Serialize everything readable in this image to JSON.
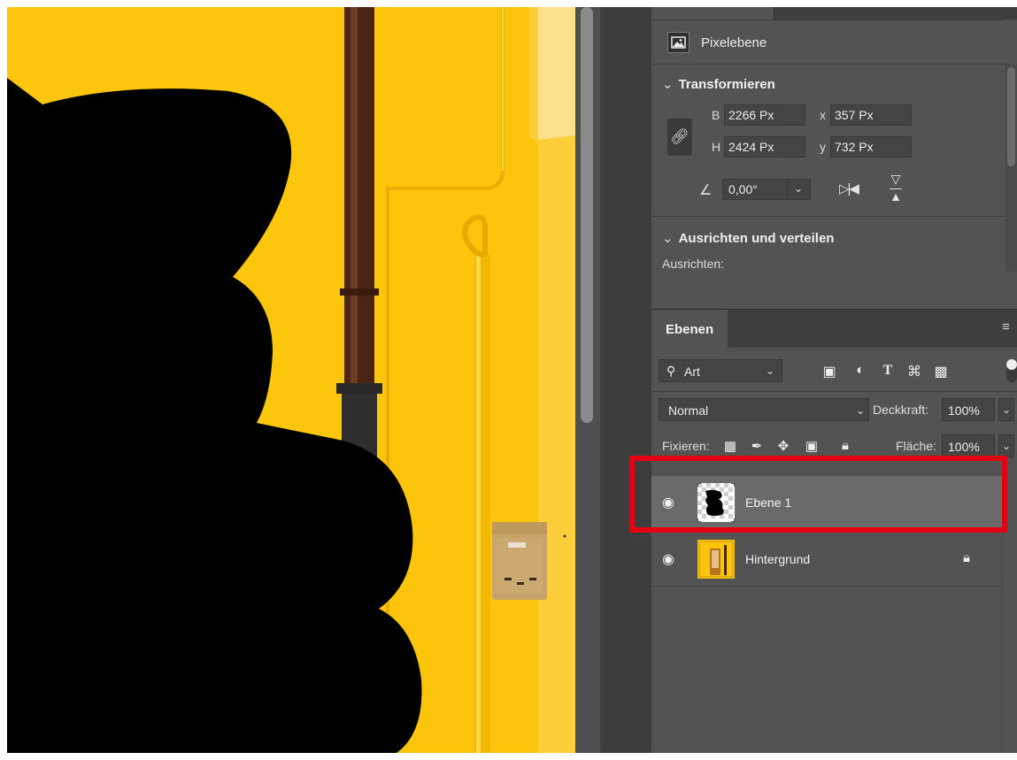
{
  "canvas": {
    "description_colors": {
      "wall": "#fcc40a",
      "wall_light": "#fddf6a",
      "pipe": "#4a2414",
      "mask": "#000000"
    }
  },
  "properties": {
    "layer_type_label": "Pixelebene",
    "transform": {
      "title": "Transformieren",
      "width_label": "B",
      "width_value": "2266 Px",
      "height_label": "H",
      "height_value": "2424 Px",
      "x_label": "x",
      "x_value": "357 Px",
      "y_label": "y",
      "y_value": "732 Px",
      "angle_value": "0,00°"
    },
    "align": {
      "title": "Ausrichten und verteilen",
      "sub_label": "Ausrichten:"
    }
  },
  "layers_panel": {
    "tab_label": "Ebenen",
    "filter_label": "Art",
    "blend_mode": "Normal",
    "opacity_label": "Deckkraft:",
    "opacity_value": "100%",
    "lock_label": "Fixieren:",
    "fill_label": "Fläche:",
    "fill_value": "100%",
    "layers": [
      {
        "name": "Ebene 1",
        "selected": true,
        "locked": false
      },
      {
        "name": "Hintergrund",
        "selected": false,
        "locked": true
      }
    ]
  },
  "annotation": {
    "highlight_color": "#e30012"
  }
}
